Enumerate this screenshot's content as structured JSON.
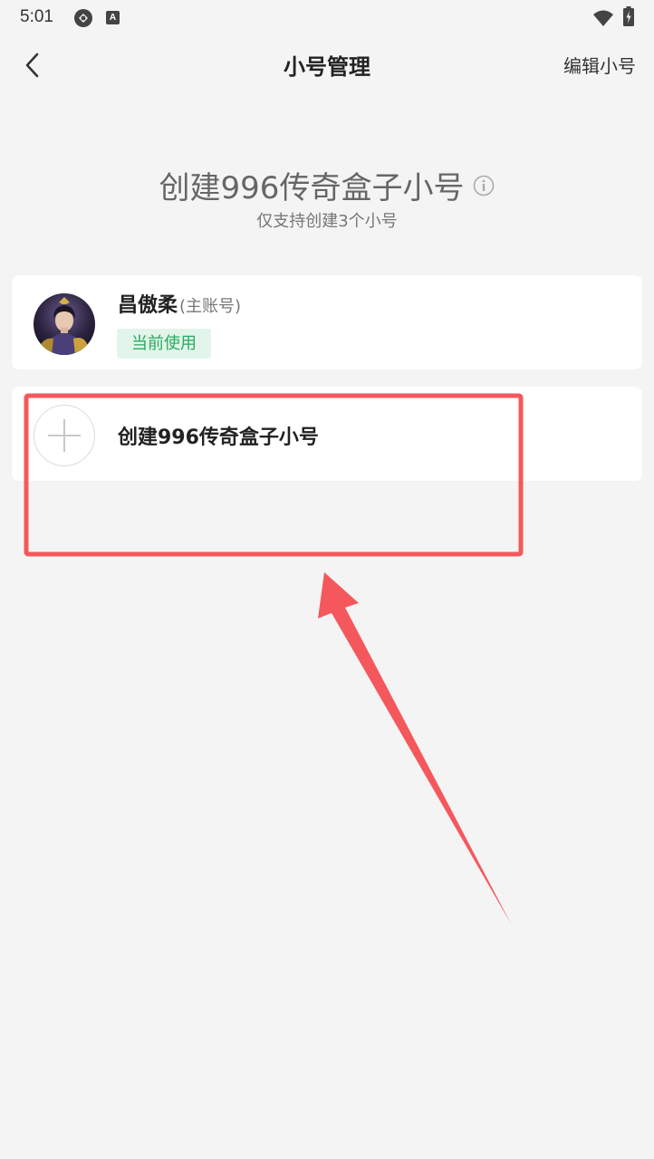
{
  "status_bar": {
    "time": "5:01",
    "icons": [
      "sync-icon",
      "a-notification-icon",
      "wifi-icon",
      "battery-icon"
    ]
  },
  "nav": {
    "back_icon": "chevron-left-icon",
    "title": "小号管理",
    "action_label": "编辑小号"
  },
  "header": {
    "title": "创建996传奇盒子小号",
    "info_icon": "info-icon",
    "subtitle": "仅支持创建3个小号"
  },
  "accounts": [
    {
      "name": "昌傲柔",
      "tag": "(主账号)",
      "badge": "当前使用"
    }
  ],
  "create_card": {
    "icon": "plus-icon",
    "label": "创建996传奇盒子小号"
  },
  "annotation": {
    "color": "#f4585d",
    "shapes": [
      "highlight-rectangle",
      "pointer-arrow"
    ]
  },
  "colors": {
    "accent_green": "#27ab5e",
    "badge_background": "#e2f5ea",
    "page_background": "#f4f4f4"
  }
}
